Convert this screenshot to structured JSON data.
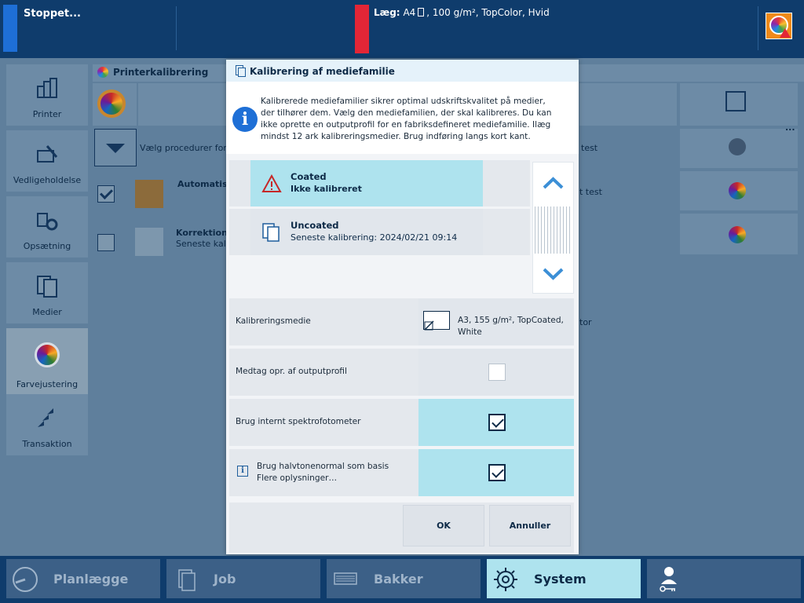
{
  "status": {
    "text": "Stoppet...",
    "load_label": "Læg:",
    "load_paper": "A4",
    "load_details": ", 100 g/m², TopColor, Hvid"
  },
  "sidebar": {
    "items": [
      {
        "label": "Printer"
      },
      {
        "label": "Vedligeholdelse"
      },
      {
        "label": "Opsætning"
      },
      {
        "label": "Medier"
      },
      {
        "label": "Farvejustering"
      },
      {
        "label": "Transaktion"
      }
    ]
  },
  "background": {
    "title": "Printerkalibrering",
    "select_procedures": "Vælg procedurer for pr",
    "automatic": "Automatisk",
    "correction": "Korrektion",
    "latest_cal": "Seneste kalib",
    "test1": "test",
    "test2": "t test",
    "tor": "tor",
    "more": "..."
  },
  "dialog": {
    "title": "Kalibrering af mediefamilie",
    "info": "Kalibrerede mediefamilier sikrer optimal udskriftskvalitet på medier, der tilhører dem. Vælg den mediefamilien, der skal kalibreres. Du kan ikke oprette en outputprofil for en fabriksdefineret mediefamilie. Ilæg mindst 12 ark kalibreringsmedier. Brug indføring langs kort kant.",
    "families": [
      {
        "name": "Coated",
        "status": "Ikke kalibreret",
        "selected": true
      },
      {
        "name": "Uncoated",
        "status": "Seneste kalibrering: 2024/02/21 09:14",
        "selected": false
      }
    ],
    "settings": {
      "media_label": "Kalibreringsmedie",
      "media_value_line1": "A3, 155 g/m², TopCoated,",
      "media_value_line2": "White",
      "include_profile_label": "Medtag opr. af outputprofil",
      "include_profile_checked": false,
      "spectro_label": "Brug internt spektrofotometer",
      "spectro_checked": true,
      "halftone_label": "Brug halvtonenormal som basis",
      "halftone_more": "Flere oplysninger…",
      "halftone_checked": true
    },
    "ok_label": "OK",
    "cancel_label": "Annuller"
  },
  "bottom_nav": [
    {
      "label": "Planlægge",
      "active": false
    },
    {
      "label": "Job",
      "active": false
    },
    {
      "label": "Bakker",
      "active": false
    },
    {
      "label": "System",
      "active": true
    },
    {
      "label": "",
      "active": false
    }
  ],
  "colors": {
    "header_bg": "#0f3c6c",
    "accent_cyan": "#aee3ee",
    "warning_red": "#e32636",
    "status_blue": "#1e6fd6"
  }
}
